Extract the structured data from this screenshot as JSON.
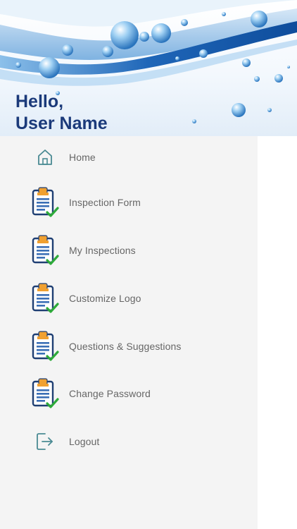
{
  "header": {
    "greeting": "Hello,",
    "user_name": "User Name"
  },
  "menu": {
    "items": [
      {
        "label": "Home",
        "icon": "home-icon"
      },
      {
        "label": "Inspection Form",
        "icon": "clipboard-check-icon"
      },
      {
        "label": "My Inspections",
        "icon": "clipboard-check-icon"
      },
      {
        "label": "Customize Logo",
        "icon": "clipboard-check-icon"
      },
      {
        "label": "Questions & Suggestions",
        "icon": "clipboard-check-icon"
      },
      {
        "label": "Change Password",
        "icon": "clipboard-check-icon"
      },
      {
        "label": "Logout",
        "icon": "logout-icon"
      }
    ]
  },
  "colors": {
    "greeting_text": "#1b3a7a",
    "menu_text": "#666666",
    "drawer_bg": "#f4f4f4",
    "icon_teal": "#4a8a93",
    "clipboard_orange": "#f0a030",
    "clipboard_blue": "#3b6fb6",
    "check_green": "#2eaa3a"
  }
}
